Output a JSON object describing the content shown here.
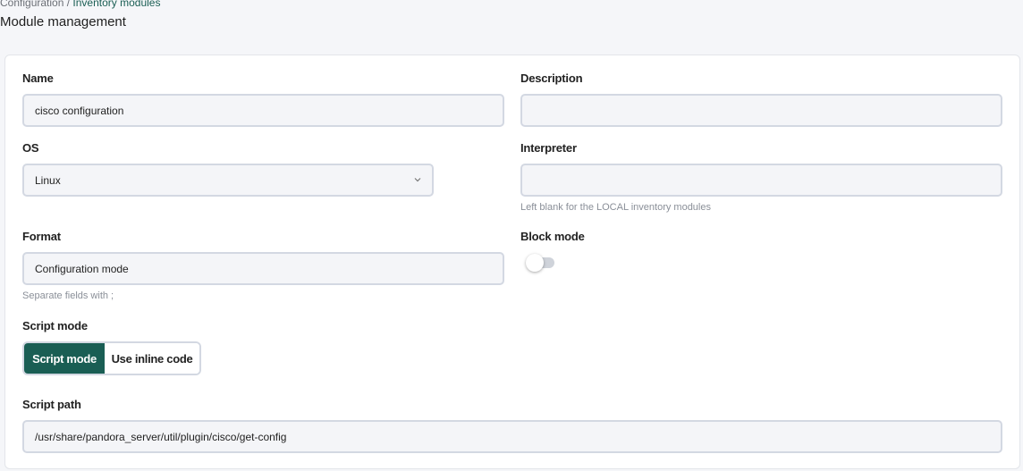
{
  "breadcrumb": {
    "parent": "Configuration",
    "separator": " / ",
    "current": "Inventory modules"
  },
  "page_title": "Module management",
  "form": {
    "name": {
      "label": "Name",
      "value": "cisco configuration"
    },
    "description": {
      "label": "Description",
      "value": ""
    },
    "os": {
      "label": "OS",
      "value": "Linux"
    },
    "interpreter": {
      "label": "Interpreter",
      "value": "",
      "hint": "Left blank for the LOCAL inventory modules"
    },
    "format": {
      "label": "Format",
      "value": "Configuration mode",
      "hint": "Separate fields with ;"
    },
    "block_mode": {
      "label": "Block mode",
      "enabled": false
    },
    "script_mode": {
      "label": "Script mode",
      "options": [
        "Script mode",
        "Use inline code"
      ],
      "selected": "Script mode"
    },
    "script_path": {
      "label": "Script path",
      "value": "/usr/share/pandora_server/util/plugin/cisco/get-config"
    }
  },
  "colors": {
    "accent": "#1a5e54",
    "field_bg": "#f4f5f8",
    "field_border": "#d3d8e2"
  },
  "icons": {
    "os_dropdown": "chevron-down-icon"
  }
}
